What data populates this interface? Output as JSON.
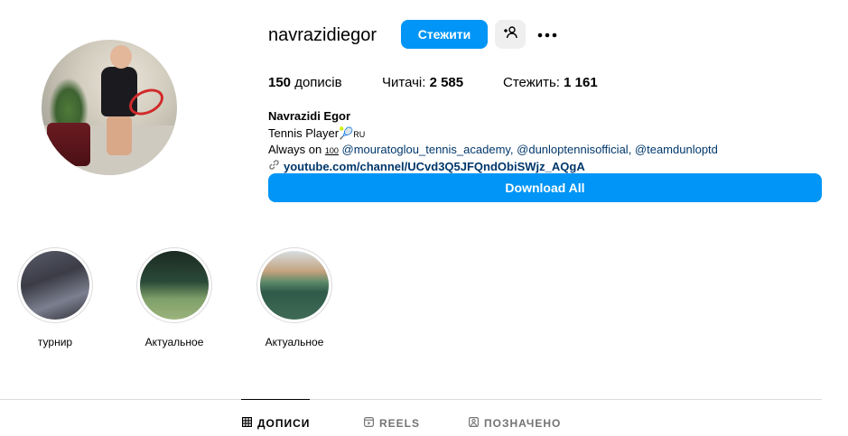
{
  "profile": {
    "username": "navrazidiegor",
    "follow_label": "Стежити",
    "stats": [
      {
        "value": "150",
        "label": "дописів",
        "prefix": ""
      },
      {
        "value": "2 585",
        "label": "",
        "prefix": "Читачі: "
      },
      {
        "value": "1 161",
        "label": "",
        "prefix": "Стежить: "
      }
    ],
    "bio": {
      "name": "Navrazidi Egor",
      "line1": "Tennis Player",
      "line1_flag": "RU",
      "line2_prefix": "Always on ",
      "line2_badge": "100",
      "mentions": "@mouratoglou_tennis_academy, @dunloptennisofficial, @teamdunloptd",
      "link": "youtube.com/channel/UCvd3Q5JFQndObiSWjz_AQgA"
    },
    "download_label": "Download All"
  },
  "highlights": [
    {
      "label": "турнир"
    },
    {
      "label": "Актуальное"
    },
    {
      "label": "Актуальное"
    }
  ],
  "tabs": [
    {
      "label": "ДОПИСИ",
      "icon": "grid-icon",
      "active": true
    },
    {
      "label": "REELS",
      "icon": "reels-icon",
      "active": false
    },
    {
      "label": "ПОЗНАЧЕНО",
      "icon": "tagged-icon",
      "active": false
    }
  ],
  "colors": {
    "accent": "#0095f6",
    "link": "#00376b",
    "divider": "#dbdbdb",
    "muted": "#737373"
  }
}
